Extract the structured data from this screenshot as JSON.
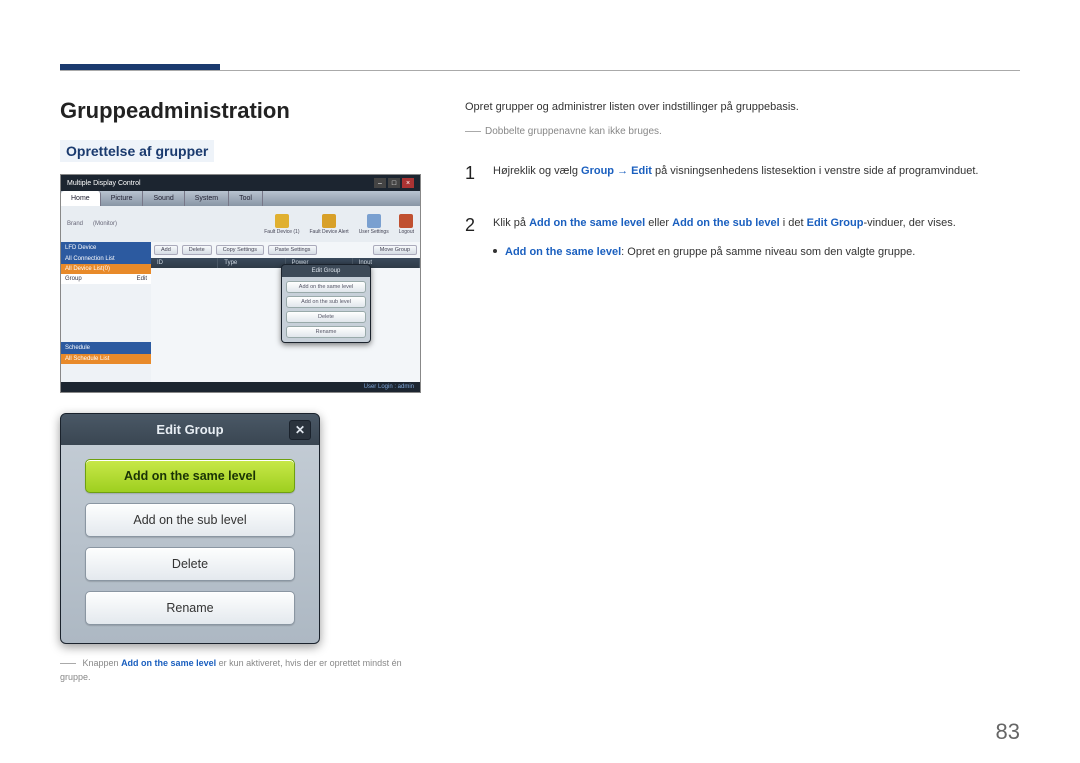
{
  "page_number": "83",
  "h1": "Gruppeadministration",
  "h2": "Oprettelse af grupper",
  "intro": "Opret grupper og administrer listen over indstillinger på gruppebasis.",
  "note": "Dobbelte gruppenavne kan ikke bruges.",
  "steps": {
    "s1": {
      "num": "1",
      "pre": "Højreklik og vælg ",
      "kw1": "Group",
      "arrow": " → ",
      "kw2": "Edit",
      "post": " på visningsenhedens listesektion i venstre side af programvinduet."
    },
    "s2": {
      "num": "2",
      "pre": "Klik på ",
      "kw1": "Add on the same level",
      "mid1": " eller ",
      "kw2": "Add on the sub level",
      "mid2": " i det ",
      "kw3": "Edit Group",
      "post": "-vinduer, der vises.",
      "bullet_kw": "Add on the same level",
      "bullet_text": ": Opret en gruppe på samme niveau som den valgte gruppe."
    }
  },
  "footnote": {
    "pre": "Knappen ",
    "kw": "Add on the same level",
    "post": " er kun aktiveret, hvis der er oprettet mindst én gruppe."
  },
  "mdc": {
    "title": "Multiple Display Control",
    "tabs": [
      "Home",
      "Picture",
      "Sound",
      "System",
      "Tool"
    ],
    "toolbar_left": [
      "Brand",
      "(Monitor)"
    ],
    "toolbar_right": [
      "Fault Device (1)",
      "Fault Device Alert",
      "User Settings",
      "Logout"
    ],
    "side": {
      "hdr1": "LFD Device",
      "row1": "All Connection List",
      "row2": "All Device List(0)",
      "group": "Group",
      "edit": "Edit",
      "hdr2": "Schedule",
      "row3": "All Schedule List"
    },
    "btnrow": [
      "Add",
      "Delete",
      "Copy Settings",
      "Paste Settings",
      "Move Group"
    ],
    "cols": [
      "ID",
      "Type",
      "Power",
      "Input"
    ],
    "popup": {
      "title": "Edit Group",
      "b1": "Add on the same level",
      "b2": "Add on the sub level",
      "b3": "Delete",
      "b4": "Rename"
    },
    "status": "User Login : admin"
  },
  "dlg": {
    "title": "Edit Group",
    "b1": "Add on the same level",
    "b2": "Add on the sub level",
    "b3": "Delete",
    "b4": "Rename"
  }
}
